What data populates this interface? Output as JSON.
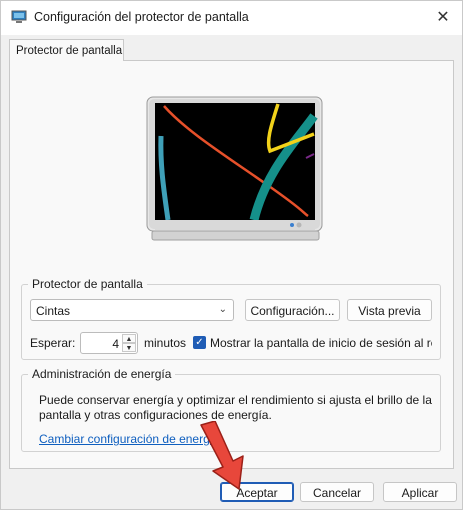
{
  "window": {
    "title": "Configuración del protector de pantalla"
  },
  "tabs": [
    {
      "label": "Protector de pantalla"
    }
  ],
  "screensaver_group": {
    "label": "Protector de pantalla",
    "selected": "Cintas",
    "settings_button": "Configuración...",
    "preview_button": "Vista previa",
    "wait_label": "Esperar:",
    "wait_value": "4",
    "minutes_label": "minutos",
    "resume_checked": true,
    "resume_label": "Mostrar la pantalla de inicio de sesión al reanudar"
  },
  "power_group": {
    "label": "Administración de energía",
    "description": "Puede conservar energía y optimizar el rendimiento si ajusta el brillo de la pantalla y otras configuraciones de energía.",
    "link": "Cambiar configuración de energía"
  },
  "buttons": {
    "ok": "Aceptar",
    "cancel": "Cancelar",
    "apply": "Aplicar"
  },
  "icons": {
    "app": "screensaver-settings-icon",
    "close": "close-icon",
    "dropdown": "chevron-down-icon",
    "annotation": "red-arrow-pointer-icon"
  },
  "colors": {
    "accent": "#1f5cb5",
    "link": "#0f5fbf",
    "annotation_arrow": "#e8473b"
  }
}
